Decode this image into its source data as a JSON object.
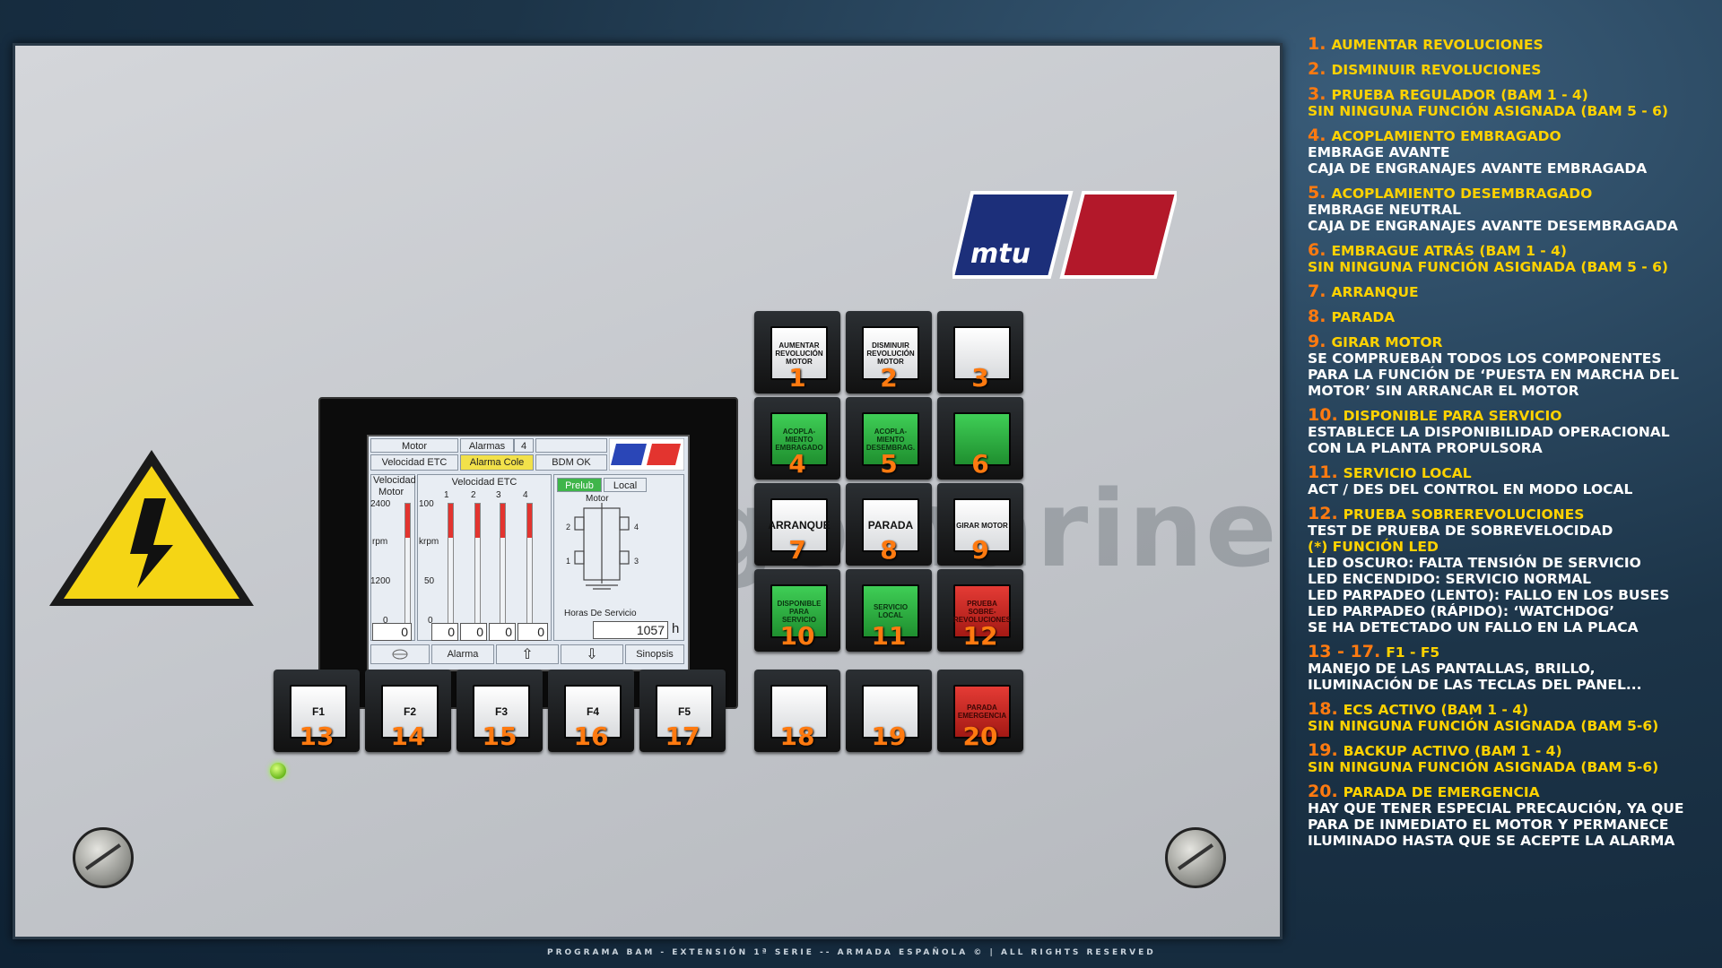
{
  "watermark": "egomarine",
  "logo_text": "mtu",
  "footer": "PROGRAMA BAM - EXTENSIÓN 1ª SERIE -- ARMADA ESPAÑOLA © | ALL RIGHTS RESERVED",
  "colors": {
    "accent": "#ff7a10",
    "legend_title": "#ffd200",
    "key_green": "#2fb341",
    "key_red": "#d62a24",
    "mtu_blue": "#1c2f7a",
    "mtu_red": "#b3182a"
  },
  "screen": {
    "motor": "Motor",
    "alarmas": "Alarmas",
    "alarmas_count": "4",
    "velocidad_etc": "Velocidad ETC",
    "alarma_cole": "Alarma Cole",
    "bdm_ok": "BDM OK",
    "velocidad": "Velocidad",
    "motor2": "Motor",
    "velocidad_etc2": "Velocidad ETC",
    "prelub": "Prelub",
    "local": "Local",
    "motor3": "Motor",
    "rpm_ticks": [
      "2400",
      "rpm",
      "1200",
      "0"
    ],
    "krpm_ticks": [
      "100",
      "krpm",
      "50",
      "0"
    ],
    "etc_nums": [
      "1",
      "2",
      "3",
      "4"
    ],
    "motor_nums": [
      "2",
      "4",
      "1",
      "3"
    ],
    "rpm_value": "0",
    "etc_values": [
      "0",
      "0",
      "0",
      "0"
    ],
    "horas_label": "Horas De Servicio",
    "horas_value": "1057",
    "horas_unit": "h",
    "bottom": {
      "alarma": "Alarma",
      "up": "⇧",
      "down": "⇩",
      "sinopsis": "Sinopsis"
    },
    "rpm_fraction": 0.0,
    "etc_fractions": [
      0.0,
      0.0,
      0.0,
      0.0
    ]
  },
  "keys": [
    {
      "num": "1",
      "label": "AUMENTAR REVOLUCIÓN MOTOR",
      "color": "white"
    },
    {
      "num": "2",
      "label": "DISMINUIR REVOLUCIÓN MOTOR",
      "color": "white"
    },
    {
      "num": "3",
      "label": "",
      "color": "white"
    },
    {
      "num": "4",
      "label": "ACOPLA-MIENTO EMBRAGADO",
      "color": "green"
    },
    {
      "num": "5",
      "label": "ACOPLA-MIENTO DESEMBRAG.",
      "color": "green"
    },
    {
      "num": "6",
      "label": "",
      "color": "green"
    },
    {
      "num": "7",
      "label": "ARRANQUE",
      "color": "white"
    },
    {
      "num": "8",
      "label": "PARADA",
      "color": "white"
    },
    {
      "num": "9",
      "label": "GIRAR MOTOR",
      "color": "white"
    },
    {
      "num": "10",
      "label": "DISPONIBLE PARA SERVICIO",
      "color": "green"
    },
    {
      "num": "11",
      "label": "SERVICIO LOCAL",
      "color": "green"
    },
    {
      "num": "12",
      "label": "PRUEBA SOBRE-REVOLUCIONES",
      "color": "red"
    },
    {
      "num": "13",
      "label": "F1",
      "color": "white"
    },
    {
      "num": "14",
      "label": "F2",
      "color": "white"
    },
    {
      "num": "15",
      "label": "F3",
      "color": "white"
    },
    {
      "num": "16",
      "label": "F4",
      "color": "white"
    },
    {
      "num": "17",
      "label": "F5",
      "color": "white"
    },
    {
      "num": "18",
      "label": "",
      "color": "white"
    },
    {
      "num": "19",
      "label": "",
      "color": "white"
    },
    {
      "num": "20",
      "label": "PARADA EMERGENCIA",
      "color": "red"
    }
  ],
  "legend": [
    {
      "n": "1.",
      "t": "AUMENTAR REVOLUCIONES"
    },
    {
      "n": "2.",
      "t": "DISMINUIR REVOLUCIONES"
    },
    {
      "n": "3.",
      "t": "PRUEBA REGULADOR (BAM 1 - 4)",
      "y": [
        "SIN NINGUNA FUNCIÓN ASIGNADA (BAM 5 - 6)"
      ]
    },
    {
      "n": "4.",
      "t": "ACOPLAMIENTO EMBRAGADO",
      "d": [
        "EMBRAGE AVANTE",
        "CAJA DE ENGRANAJES AVANTE EMBRAGADA"
      ]
    },
    {
      "n": "5.",
      "t": "ACOPLAMIENTO DESEMBRAGADO",
      "d": [
        "EMBRAGE NEUTRAL",
        "CAJA DE ENGRANAJES AVANTE DESEMBRAGADA"
      ]
    },
    {
      "n": "6.",
      "t": "EMBRAGUE ATRÁS (BAM 1 - 4)",
      "y": [
        "SIN NINGUNA FUNCIÓN ASIGNADA (BAM 5 - 6)"
      ]
    },
    {
      "n": "7.",
      "t": "ARRANQUE"
    },
    {
      "n": "8.",
      "t": "PARADA"
    },
    {
      "n": "9.",
      "t": "GIRAR MOTOR",
      "d": [
        "SE COMPRUEBAN TODOS LOS COMPONENTES",
        "PARA LA FUNCIÓN DE ‘PUESTA EN MARCHA DEL",
        "MOTOR’ SIN ARRANCAR EL MOTOR"
      ]
    },
    {
      "n": "10.",
      "t": "DISPONIBLE PARA SERVICIO",
      "d": [
        "ESTABLECE LA DISPONIBILIDAD OPERACIONAL",
        "CON LA PLANTA PROPULSORA"
      ]
    },
    {
      "n": "11.",
      "t": "SERVICIO LOCAL",
      "d": [
        "ACT / DES DEL CONTROL EN MODO LOCAL"
      ]
    },
    {
      "n": "12.",
      "t": "PRUEBA SOBREREVOLUCIONES",
      "d": [
        "TEST DE PRUEBA DE SOBREVELOCIDAD"
      ],
      "y": [
        "(*) FUNCIÓN LED"
      ],
      "d2": [
        "LED OSCURO: FALTA TENSIÓN DE SERVICIO",
        "LED ENCENDIDO: SERVICIO NORMAL",
        "LED PARPADEO (LENTO): FALLO EN LOS BUSES",
        "LED PARPADEO (RÁPIDO): ‘WATCHDOG’",
        "SE HA DETECTADO UN FALLO EN LA PLACA"
      ]
    },
    {
      "n": "13 - 17.",
      "t": "F1 - F5",
      "d": [
        "MANEJO DE LAS PANTALLAS, BRILLO,",
        "ILUMINACIÓN DE LAS TECLAS DEL PANEL..."
      ]
    },
    {
      "n": "18.",
      "t": "ECS ACTIVO (BAM 1 - 4)",
      "y": [
        "SIN NINGUNA FUNCIÓN ASIGNADA (BAM 5-6)"
      ]
    },
    {
      "n": "19.",
      "t": "BACKUP ACTIVO (BAM 1 - 4)",
      "y": [
        "SIN NINGUNA FUNCIÓN ASIGNADA (BAM 5-6)"
      ]
    },
    {
      "n": "20.",
      "t": "PARADA DE EMERGENCIA",
      "d": [
        "HAY QUE TENER ESPECIAL PRECAUCIÓN, YA QUE",
        "PARA DE INMEDIATO EL MOTOR Y PERMANECE",
        "ILUMINADO HASTA QUE SE ACEPTE LA ALARMA"
      ]
    }
  ]
}
